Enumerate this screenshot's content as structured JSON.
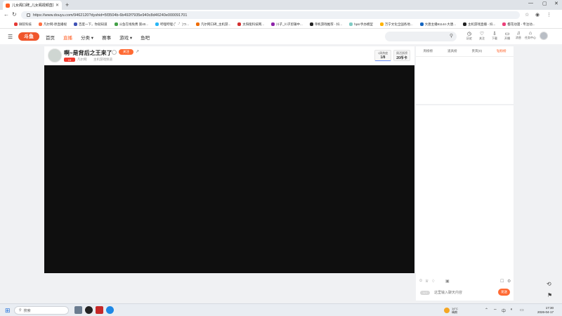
{
  "browser": {
    "tab_title": "儿女阁口碑_儿女阁视频直播_儿女阁口碑...",
    "address": "https://www.douyu.com/9462120?dyshid=5f3504b-6b492f7935e940c8d46240e000091701",
    "bookmarks": [
      {
        "label": "微软科技",
        "color": "#e53935"
      },
      {
        "label": "凡尔网-原直播视",
        "color": "#ff7043"
      },
      {
        "label": "百度一下，你就知道",
        "color": "#3f51b5"
      },
      {
        "label": "斗鱼在线免费 第40...",
        "color": "#43a047"
      },
      {
        "label": "哔哩哔哩 (゜-゜)つ...",
        "color": "#29b6f6"
      },
      {
        "label": "凡尔网口碑_主机游...",
        "color": "#ef6c00"
      },
      {
        "label": "太阳能科技网...",
        "color": "#d32f2f"
      },
      {
        "label": "川子_川子剪辑中...",
        "color": "#8e24aa"
      },
      {
        "label": "单机游戏推荐 - 抖...",
        "color": "#212121"
      },
      {
        "label": "hpsr手办模型",
        "color": "#80cbc4"
      },
      {
        "label": "万宁文化全国各地...",
        "color": "#ffb300"
      },
      {
        "label": "大唐主播91144-大唐...",
        "color": "#1565c0"
      },
      {
        "label": "主机游戏直播 - 抖...",
        "color": "#212121"
      },
      {
        "label": "樱花动漫 - 专注动...",
        "color": "#ec407a"
      }
    ]
  },
  "site": {
    "logo": "斗鱼",
    "nav": [
      {
        "label": "首页",
        "active": false
      },
      {
        "label": "直播",
        "active": true
      },
      {
        "label": "分类 ▾",
        "active": false
      },
      {
        "label": "赛事",
        "active": false
      },
      {
        "label": "游戏 ▾",
        "active": false
      },
      {
        "label": "鱼吧",
        "active": false
      }
    ],
    "header_items": [
      {
        "icon": "◷",
        "label": "历史"
      },
      {
        "icon": "♡",
        "label": "关注"
      },
      {
        "icon": "⇩",
        "label": "下载"
      },
      {
        "icon": "▭",
        "label": "开播"
      },
      {
        "icon": "♫",
        "label": "消息"
      },
      {
        "icon": "⌂",
        "label": "任务中心"
      }
    ]
  },
  "room": {
    "title": "啊~是背后之王来了",
    "follow": "关注",
    "level": "19",
    "category": "凡尔网",
    "name": "主机游戏频道",
    "rank_label": "1周热度",
    "rank_value": "1/8",
    "gift_label": "周活跃榜",
    "gift_value": "20币卡"
  },
  "right_panel": {
    "tabs": [
      {
        "label": "周榜榜",
        "active": false
      },
      {
        "label": "道具榜",
        "active": false
      },
      {
        "label": "贵宾(0)",
        "active": false
      },
      {
        "label": "钻粉榜",
        "active": true
      }
    ],
    "level_badge": "Lv.1",
    "chat_placeholder": "这里输入聊天内容",
    "send": "发送"
  },
  "taskbar": {
    "search": "搜索",
    "weather_temp": "14°C",
    "weather_desc": "晴朗",
    "time": "17:30",
    "date": "2026-04-17",
    "ime": "中"
  }
}
